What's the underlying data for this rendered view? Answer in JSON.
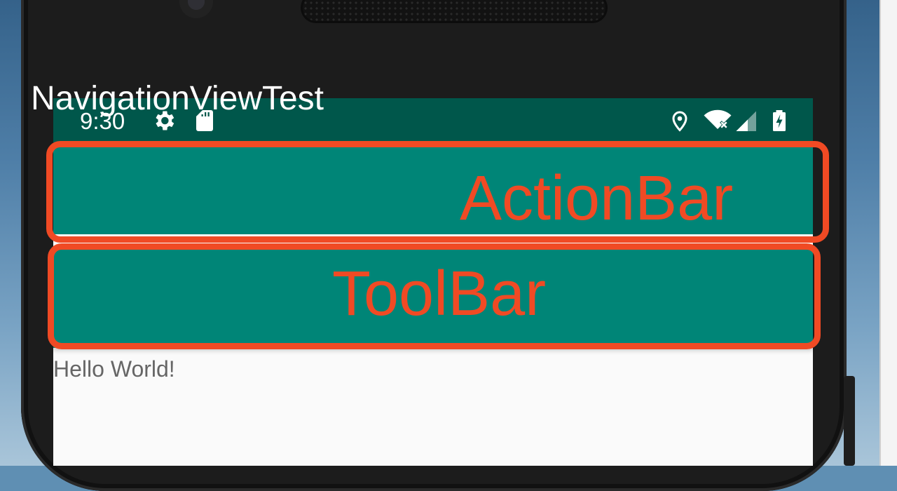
{
  "status_bar": {
    "time": "9:30",
    "left_icons": [
      "gear-icon",
      "sd-card-icon"
    ],
    "right_icons": [
      "location-icon",
      "wifi-off-icon",
      "signal-icon",
      "battery-charging-icon"
    ]
  },
  "action_bar": {
    "title": "NavigationViewTest"
  },
  "content": {
    "text": "Hello World!"
  },
  "annotations": {
    "action_bar_label": "ActionBar",
    "toolbar_label": "ToolBar",
    "color": "#f04a24"
  },
  "colors": {
    "primary": "#008577",
    "primary_dark": "#00574b",
    "background": "#fafafa"
  }
}
